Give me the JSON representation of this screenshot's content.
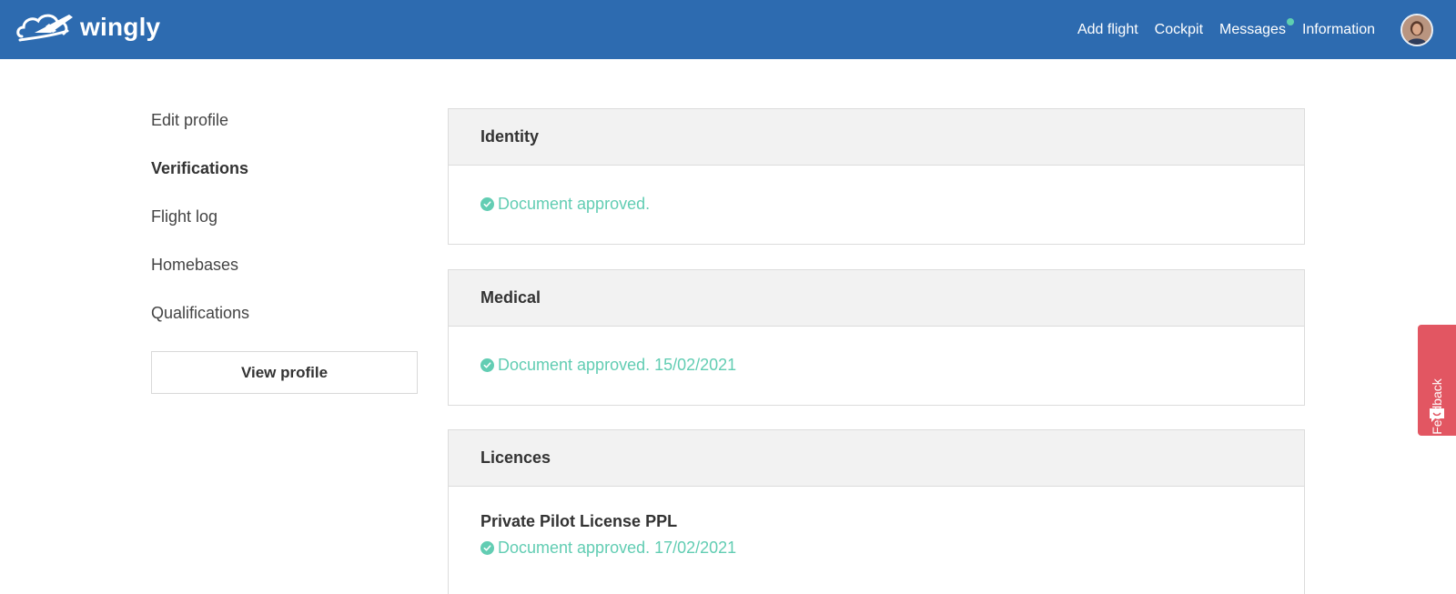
{
  "brand": {
    "name": "wingly"
  },
  "nav": {
    "add_flight": "Add flight",
    "cockpit": "Cockpit",
    "messages": "Messages",
    "information": "Information"
  },
  "sidebar": {
    "items": [
      {
        "label": "Edit profile",
        "active": false
      },
      {
        "label": "Verifications",
        "active": true
      },
      {
        "label": "Flight log",
        "active": false
      },
      {
        "label": "Homebases",
        "active": false
      },
      {
        "label": "Qualifications",
        "active": false
      }
    ],
    "view_profile": "View profile"
  },
  "sections": {
    "identity": {
      "title": "Identity",
      "status": "Document approved."
    },
    "medical": {
      "title": "Medical",
      "status": "Document approved. 15/02/2021"
    },
    "licences": {
      "title": "Licences",
      "licence_name": "Private Pilot License PPL",
      "status": "Document approved. 17/02/2021"
    }
  },
  "feedback": {
    "label": "Feedback"
  },
  "colors": {
    "header": "#2d6bb0",
    "approved": "#62cdb3",
    "feedback": "#e25662",
    "notification_dot": "#5ecfb0"
  },
  "icons": {
    "logo": "wingly-plane-cloud-icon",
    "check": "check-circle-icon",
    "feedback": "chat-smile-icon"
  }
}
